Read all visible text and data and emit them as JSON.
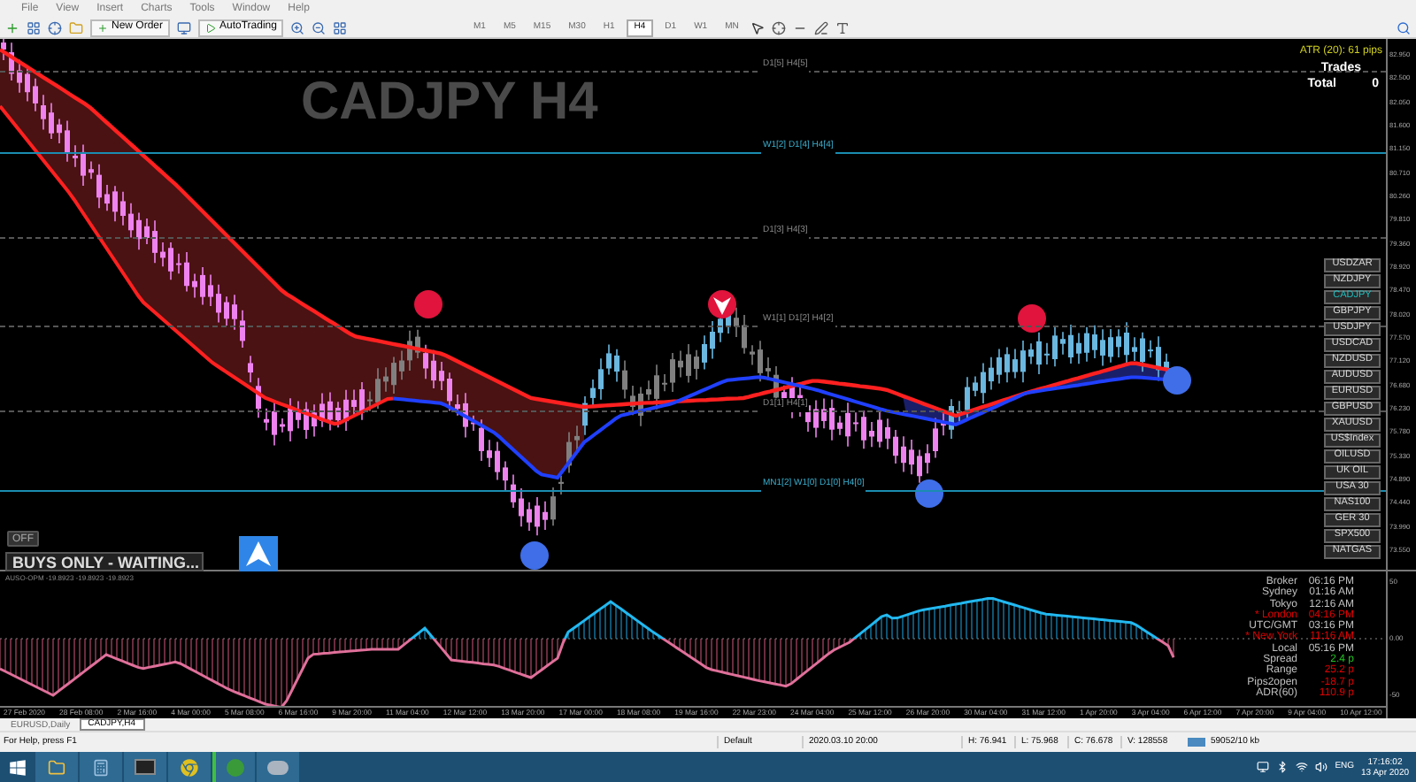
{
  "menu": [
    "File",
    "View",
    "Insert",
    "Charts",
    "Tools",
    "Window",
    "Help"
  ],
  "toolbar": {
    "new_order": "New Order",
    "autotrading": "AutoTrading",
    "timeframes": [
      {
        "label": "M1",
        "selected": false
      },
      {
        "label": "M5",
        "selected": false
      },
      {
        "label": "M15",
        "selected": false
      },
      {
        "label": "M30",
        "selected": false
      },
      {
        "label": "H1",
        "selected": false
      },
      {
        "label": "H4",
        "selected": true
      },
      {
        "label": "D1",
        "selected": false
      },
      {
        "label": "W1",
        "selected": false
      },
      {
        "label": "MN",
        "selected": false
      }
    ]
  },
  "chart": {
    "title": "CADJPY H4",
    "atr": "ATR (20): 61 pips",
    "trades_title": "Trades",
    "total_label": "Total",
    "total_value": "0",
    "levels": [
      {
        "label": "D1[5] H4[5]",
        "kind": "dashed"
      },
      {
        "label": "W1[2] D1[4] H4[4]",
        "kind": "solid"
      },
      {
        "label": "D1[3] H4[3]",
        "kind": "dashed"
      },
      {
        "label": "W1[1] D1[2] H4[2]",
        "kind": "dashed"
      },
      {
        "label": "D1[1] H4[1]",
        "kind": "dashed"
      },
      {
        "label": "MN1[2] W1[0] D1[0] H4[0]",
        "kind": "solid"
      }
    ],
    "price_axis": [
      "82.950",
      "82.500",
      "82.050",
      "81.600",
      "81.150",
      "80.710",
      "80.260",
      "79.810",
      "79.360",
      "78.920",
      "78.470",
      "78.020",
      "77.570",
      "77.120",
      "76.680",
      "76.230",
      "75.780",
      "75.330",
      "74.890",
      "74.440",
      "73.990",
      "73.550"
    ],
    "symbols": [
      {
        "label": "USDZAR",
        "selected": false
      },
      {
        "label": "NZDJPY",
        "selected": false
      },
      {
        "label": "CADJPY",
        "selected": true
      },
      {
        "label": "GBPJPY",
        "selected": false
      },
      {
        "label": "USDJPY",
        "selected": false
      },
      {
        "label": "USDCAD",
        "selected": false
      },
      {
        "label": "NZDUSD",
        "selected": false
      },
      {
        "label": "AUDUSD",
        "selected": false
      },
      {
        "label": "EURUSD",
        "selected": false
      },
      {
        "label": "GBPUSD",
        "selected": false
      },
      {
        "label": "XAUUSD",
        "selected": false
      },
      {
        "label": "US$Index",
        "selected": false
      },
      {
        "label": "OILUSD",
        "selected": false
      },
      {
        "label": "UK OIL",
        "selected": false
      },
      {
        "label": "USA 30",
        "selected": false
      },
      {
        "label": "NAS100",
        "selected": false
      },
      {
        "label": "GER 30",
        "selected": false
      },
      {
        "label": "SPX500",
        "selected": false
      },
      {
        "label": "NATGAS",
        "selected": false
      }
    ],
    "off_button": "OFF",
    "banner": "BUYS ONLY - WAITING..."
  },
  "indicator": {
    "title": "AUSO-OPM -19.8923 -19.8923 -19.8923",
    "axis": [
      "50",
      "0.00",
      "-50"
    ],
    "info": [
      {
        "label": "Broker",
        "value": "06:16 PM",
        "color": "#c0c0c0"
      },
      {
        "label": "Sydney",
        "value": "01:16 AM",
        "color": "#c0c0c0"
      },
      {
        "label": "Tokyo",
        "value": "12:16 AM",
        "color": "#c0c0c0"
      },
      {
        "label": "* London",
        "value": "04:16 PM",
        "color": "#e00000"
      },
      {
        "label": "UTC/GMT",
        "value": "03:16 PM",
        "color": "#c0c0c0"
      },
      {
        "label": "* New York",
        "value": "11:16 AM",
        "color": "#e00000"
      },
      {
        "label": "Local",
        "value": "05:16 PM",
        "color": "#c0c0c0"
      },
      {
        "label": "Spread",
        "value": "2.4 p",
        "color": "#22c022"
      },
      {
        "label": "Range",
        "value": "25.2 p",
        "color": "#e00000"
      },
      {
        "label": "Pips2open",
        "value": "-18.7 p",
        "color": "#e00000"
      },
      {
        "label": "ADR(60)",
        "value": "110.9 p",
        "color": "#e00000"
      }
    ]
  },
  "time_axis": [
    "27 Feb 2020",
    "28 Feb 08:00",
    "2 Mar 16:00",
    "4 Mar 00:00",
    "5 Mar 08:00",
    "6 Mar 16:00",
    "9 Mar 20:00",
    "11 Mar 04:00",
    "12 Mar 12:00",
    "13 Mar 20:00",
    "17 Mar 00:00",
    "18 Mar 08:00",
    "19 Mar 16:00",
    "22 Mar 23:00",
    "24 Mar 04:00",
    "25 Mar 12:00",
    "26 Mar 20:00",
    "30 Mar 04:00",
    "31 Mar 12:00",
    "1 Apr 20:00",
    "3 Apr 04:00",
    "6 Apr 12:00",
    "7 Apr 20:00",
    "9 Apr 04:00",
    "10 Apr 12:00"
  ],
  "tabs": [
    {
      "label": "EURUSD,Daily",
      "selected": false
    },
    {
      "label": "CADJPY,H4",
      "selected": true
    }
  ],
  "status_bar": {
    "help": "For Help, press F1",
    "profile": "Default",
    "time": "2020.03.10 20:00",
    "high": "H: 76.941",
    "low": "L: 75.968",
    "close": "C: 76.678",
    "volume": "V: 128558",
    "traffic": "59052/10 kb"
  },
  "taskbar": {
    "language": "ENG",
    "time": "17:16:02",
    "date": "13 Apr 2020"
  }
}
